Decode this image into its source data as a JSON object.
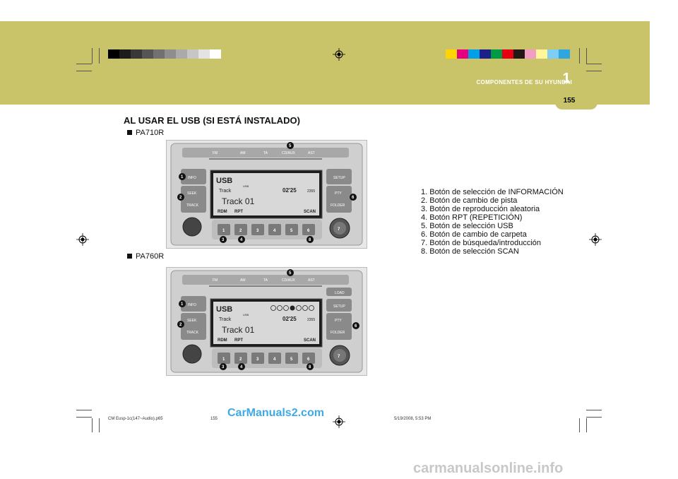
{
  "header": {
    "section_title": "COMPONENTES DE SU HYUNDAI",
    "chapter_number": "1",
    "page_number": "155",
    "band_color": "#c9c46a"
  },
  "swatches": {
    "gray": [
      "#000000",
      "#1c1c1c",
      "#383838",
      "#555555",
      "#717171",
      "#8e8e8e",
      "#aaaaaa",
      "#c6c6c6",
      "#e3e3e3",
      "#ffffff"
    ],
    "color": [
      "#ffd400",
      "#e4007f",
      "#00a0e9",
      "#1d2088",
      "#009944",
      "#e60012",
      "#231815",
      "#f19ec2",
      "#fff799",
      "#7ecef4",
      "#2ea7e0"
    ]
  },
  "content": {
    "heading": "AL USAR EL USB (SI ESTÁ INSTALADO)",
    "model1": "PA710R",
    "model2": "PA760R",
    "legend": [
      "1. Botón de selección de INFORMACIÓN",
      "2. Botón de cambio de pista",
      "3. Botón de reproducción aleatoria",
      "4. Botón RPT (REPETICIÓN)",
      "5. Botón de selección USB",
      "6. Botón de cambio de carpeta",
      "7. Botón de búsqueda/introducción",
      "8. Botón de selección SCAN"
    ]
  },
  "radio": {
    "top_buttons": [
      "FM",
      "AM",
      "TA",
      "CD/AUX",
      "AST"
    ],
    "left_buttons": [
      "INFO",
      "SEEK",
      "TRACK"
    ],
    "right_buttons_710": [
      "SETUP",
      "PTY",
      "FOLDER"
    ],
    "right_buttons_760": [
      "LOAD",
      "SETUP",
      "PTY",
      "FOLDER"
    ],
    "presets": [
      "1",
      "2",
      "3",
      "4",
      "5",
      "6"
    ],
    "display_source": "USB",
    "display_sub": "USB",
    "display_track_label": "Track",
    "display_time": "02'25",
    "display_folder": "2355",
    "display_track": "Track 01",
    "display_rdm": "RDM",
    "display_rpt": "RPT",
    "display_scan": "SCAN",
    "callouts": [
      "1",
      "2",
      "3",
      "4",
      "5",
      "6",
      "7",
      "8"
    ]
  },
  "footer": {
    "file": "CM Eusp-1c(147~Audio).p65",
    "page": "155",
    "date": "5/19/2008, 5:53 PM",
    "watermark1": "CarManuals2.com",
    "watermark2": "carmanualsonline.info"
  }
}
